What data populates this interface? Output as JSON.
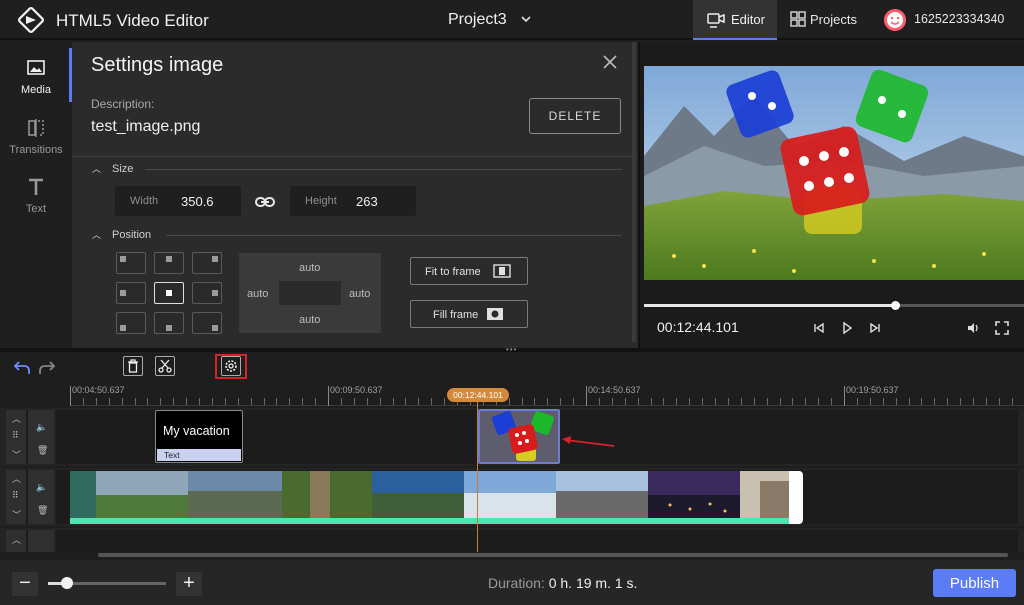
{
  "header": {
    "app_title": "HTML5 Video Editor",
    "project_title": "Project3",
    "nav_editor": "Editor",
    "nav_projects": "Projects",
    "user_id": "1625223334340"
  },
  "sidebar": {
    "items": [
      {
        "label": "Media",
        "icon": "image-icon"
      },
      {
        "label": "Transitions",
        "icon": "transitions-icon"
      },
      {
        "label": "Text",
        "icon": "text-icon"
      }
    ]
  },
  "settings": {
    "title": "Settings image",
    "description_label": "Description:",
    "description_value": "test_image.png",
    "delete_label": "DELETE",
    "size_section": "Size",
    "width_label": "Width",
    "width_value": "350.6",
    "height_label": "Height",
    "height_value": "263",
    "position_section": "Position",
    "offset_top": "auto",
    "offset_left": "auto",
    "offset_right": "auto",
    "offset_bottom": "auto",
    "fit_label": "Fit to frame",
    "fill_label": "Fill frame"
  },
  "preview": {
    "timecode": "00:12:44.101",
    "progress": 0.66
  },
  "timeline": {
    "ruler_labels": [
      "00:04:50.637",
      "00:09:50.637",
      "00:14:50.637",
      "00:19:50.637"
    ],
    "playhead": "00:12:44.101",
    "text_clip_name": "My vacation",
    "text_clip_tag": "Text"
  },
  "bottom": {
    "zoom_minus": "−",
    "zoom_plus": "+",
    "zoom_level": 0.16,
    "duration_label": "Duration:",
    "duration_value": "0 h. 19 m. 1 s.",
    "publish_label": "Publish"
  },
  "colors": {
    "accent": "#5b7cf5",
    "playhead": "#d48a3a",
    "highlight": "#d8222a",
    "video_track": "#4ce6b0"
  }
}
